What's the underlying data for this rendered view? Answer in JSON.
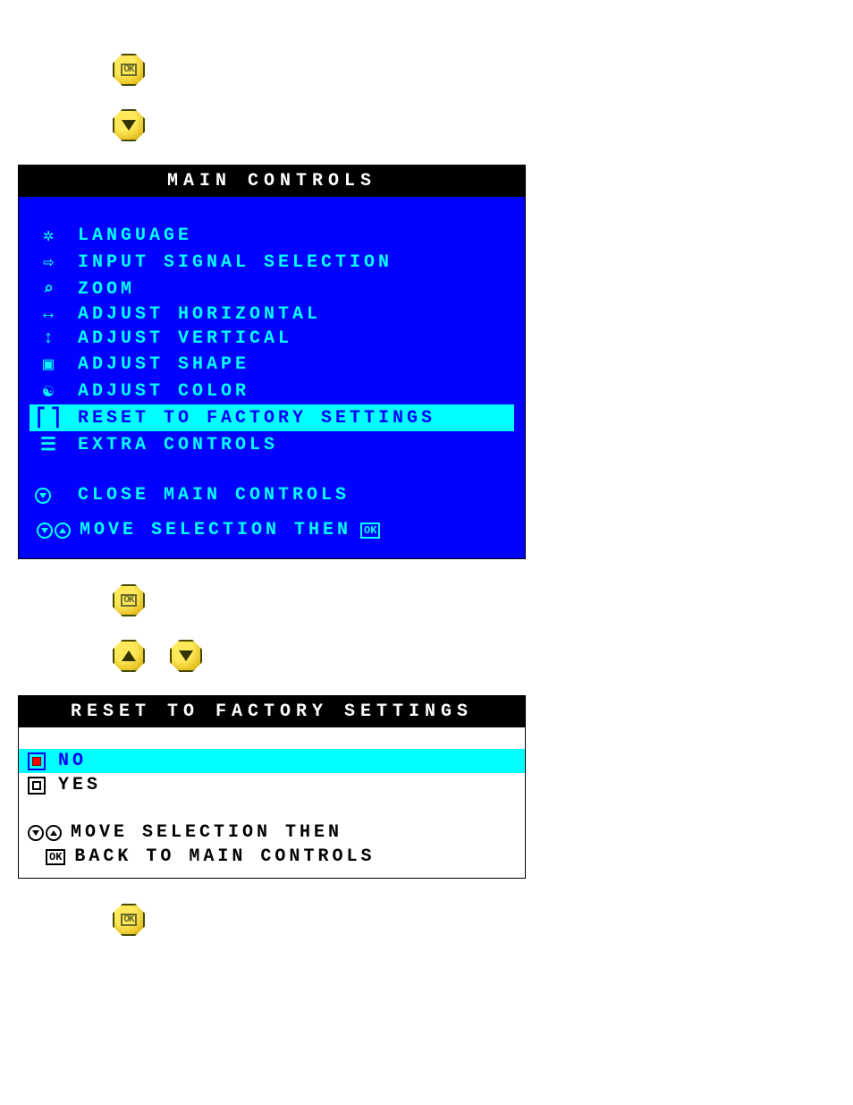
{
  "buttons": {
    "ok": "OK",
    "up": "▲",
    "down": "▼"
  },
  "main_osd": {
    "title": "MAIN CONTROLS",
    "items": [
      {
        "label": "LANGUAGE"
      },
      {
        "label": "INPUT SIGNAL SELECTION"
      },
      {
        "label": "ZOOM"
      },
      {
        "label": "ADJUST HORIZONTAL"
      },
      {
        "label": "ADJUST VERTICAL"
      },
      {
        "label": "ADJUST SHAPE"
      },
      {
        "label": "ADJUST COLOR"
      },
      {
        "label": "RESET TO FACTORY SETTINGS",
        "highlight": true
      },
      {
        "label": "EXTRA CONTROLS"
      }
    ],
    "close_label": "CLOSE MAIN CONTROLS",
    "footer_text": "MOVE SELECTION THEN",
    "footer_ok": "OK"
  },
  "reset_osd": {
    "title": "RESET TO FACTORY SETTINGS",
    "options": [
      {
        "label": "NO",
        "highlight": true
      },
      {
        "label": "YES"
      }
    ],
    "footer_move": "MOVE SELECTION THEN",
    "footer_back": "BACK TO MAIN CONTROLS",
    "footer_ok": "OK"
  }
}
